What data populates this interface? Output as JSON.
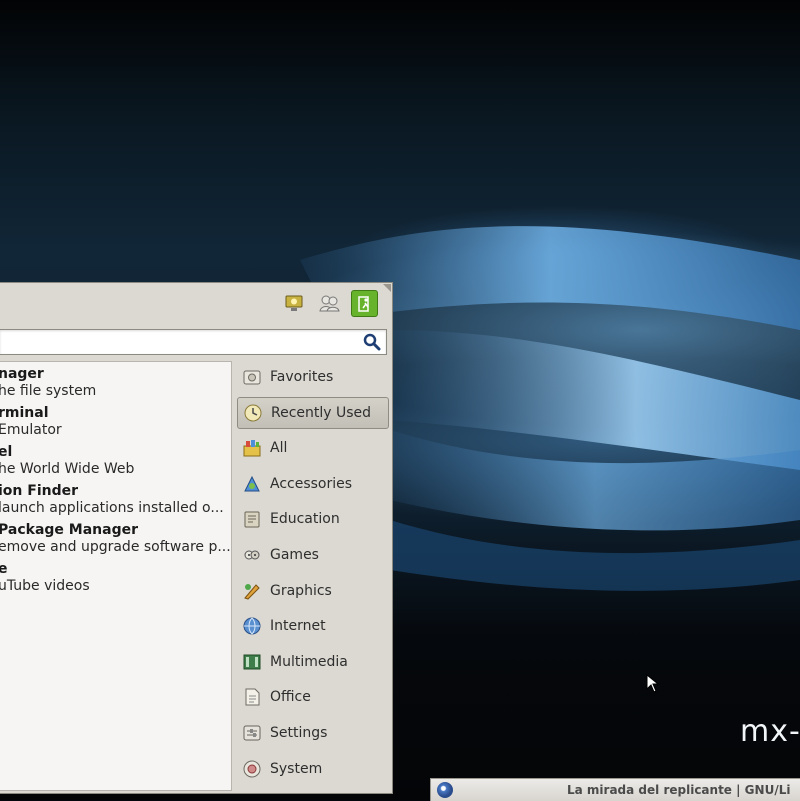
{
  "desktop": {
    "brand_text": "mx-",
    "background_colors": {
      "top": "#020304",
      "wave_light": "#78b9eb",
      "wave_dark": "#112637"
    }
  },
  "taskbar": {
    "window_title": "La mirada del replicante | GNU/Li"
  },
  "menu": {
    "header_icons": [
      "settings-monitor-icon",
      "users-icon",
      "logout-icon"
    ],
    "search": {
      "value": "",
      "placeholder": ""
    },
    "apps": [
      {
        "name": "nager",
        "description": "he file system"
      },
      {
        "name": "rminal",
        "description": " Emulator"
      },
      {
        "name": "el",
        "description": "he World Wide Web"
      },
      {
        "name": "ion Finder",
        "description": "launch applications installed o..."
      },
      {
        "name": " Package Manager",
        "description": "emove and upgrade software p..."
      },
      {
        "name": "e",
        "description": "uTube videos"
      }
    ],
    "categories": [
      {
        "label": "Favorites",
        "icon": "favorites-icon",
        "active": false
      },
      {
        "label": "Recently Used",
        "icon": "clock-icon",
        "active": true
      },
      {
        "label": "All",
        "icon": "all-apps-icon",
        "active": false
      },
      {
        "label": "Accessories",
        "icon": "accessories-icon",
        "active": false
      },
      {
        "label": "Education",
        "icon": "education-icon",
        "active": false
      },
      {
        "label": "Games",
        "icon": "games-icon",
        "active": false
      },
      {
        "label": "Graphics",
        "icon": "graphics-icon",
        "active": false
      },
      {
        "label": "Internet",
        "icon": "internet-globe-icon",
        "active": false
      },
      {
        "label": "Multimedia",
        "icon": "multimedia-icon",
        "active": false
      },
      {
        "label": "Office",
        "icon": "office-icon",
        "active": false
      },
      {
        "label": "Settings",
        "icon": "settings-icon",
        "active": false
      },
      {
        "label": "System",
        "icon": "system-icon",
        "active": false
      }
    ]
  }
}
